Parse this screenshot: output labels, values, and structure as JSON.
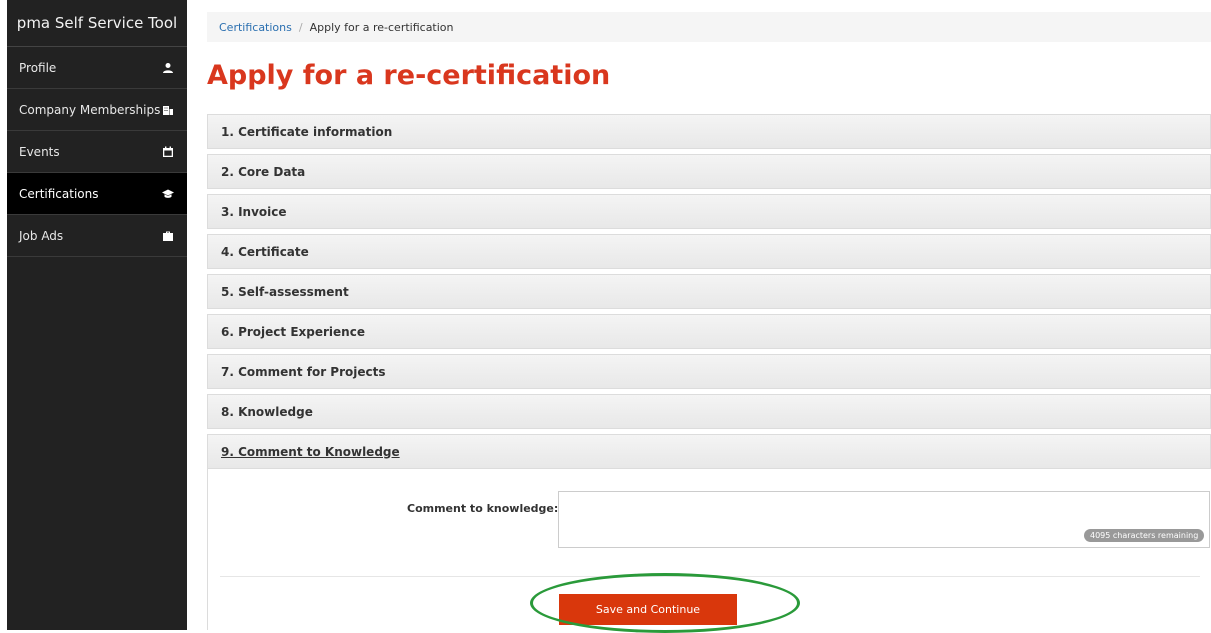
{
  "sidebar": {
    "brand": "pma Self Service Tool",
    "items": [
      {
        "label": "Profile",
        "icon": "person-icon",
        "active": false
      },
      {
        "label": "Company Memberships",
        "icon": "building-icon",
        "active": false
      },
      {
        "label": "Events",
        "icon": "calendar-icon",
        "active": false
      },
      {
        "label": "Certifications",
        "icon": "graduation-cap-icon",
        "active": true
      },
      {
        "label": "Job Ads",
        "icon": "briefcase-icon",
        "active": false
      }
    ]
  },
  "breadcrumb": {
    "link": "Certifications",
    "separator": "/",
    "current": "Apply for a re-certification"
  },
  "page": {
    "title": "Apply for a re-certification"
  },
  "accordion": {
    "sections": [
      "1. Certificate information",
      "2. Core Data",
      "3. Invoice",
      "4. Certificate",
      "5. Self-assessment",
      "6. Project Experience",
      "7. Comment for Projects",
      "8. Knowledge",
      "9. Comment to Knowledge"
    ]
  },
  "form": {
    "comment_label": "Comment to knowledge:",
    "comment_value": "",
    "chars_remaining": "4095 characters remaining",
    "save_label": "Save and Continue"
  },
  "colors": {
    "accent": "#d9371e",
    "button": "#d9370c",
    "highlight": "#2a9a3a"
  }
}
